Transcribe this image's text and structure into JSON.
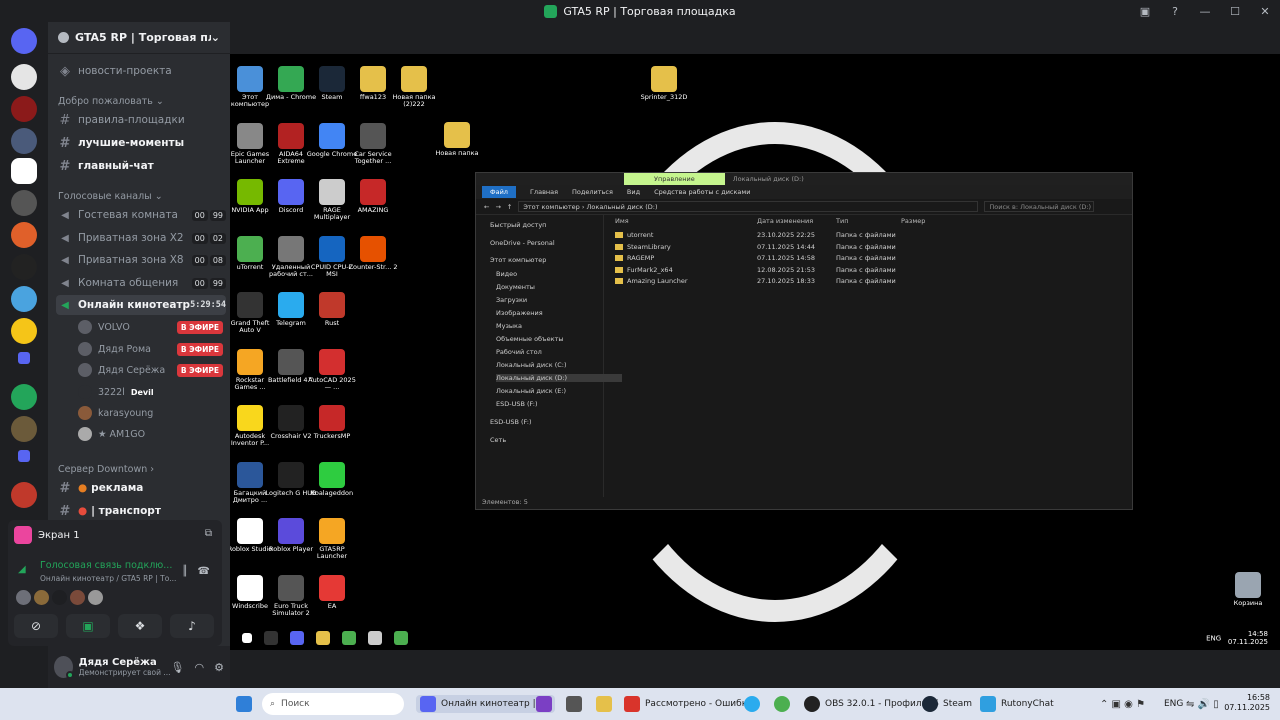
{
  "window": {
    "title": "GTA5 RP | Торговая площадка"
  },
  "server": {
    "name": "GTA5 RP | Торговая пло..."
  },
  "channels": {
    "news": "новости-проекта",
    "welcome_category": "Добро пожаловать",
    "rules": "правила-площадки",
    "best_moments": "лучшие-моменты",
    "main_chat": "главный-чат",
    "voice_category": "Голосовые каналы",
    "voice": [
      {
        "name": "Гостевая комната",
        "a": "00",
        "b": "99"
      },
      {
        "name": "Приватная зона X2",
        "a": "00",
        "b": "02"
      },
      {
        "name": "Приватная зона X8",
        "a": "00",
        "b": "08"
      },
      {
        "name": "Комната общения",
        "a": "00",
        "b": "99"
      }
    ],
    "cinema": {
      "name": "Онлайн кинотеатр",
      "timer": "5:29:54"
    },
    "cinema_users": [
      {
        "name": "VOLVO",
        "live": "В ЭФИРЕ"
      },
      {
        "name": "Дядя Рома",
        "live": "В ЭФИРЕ"
      },
      {
        "name": "Дядя Серёжа",
        "live": "В ЭФИРЕ"
      },
      {
        "name": "3222l",
        "tag": "Devil"
      },
      {
        "name": "karasyoung"
      },
      {
        "name": "★ AM1GO"
      }
    ],
    "downtown_category": "Сервер Downtown",
    "ads": "реклама",
    "transport": "| транспорт"
  },
  "voice_panel": {
    "screen": "Экран 1",
    "status": "Голосовая связь подклю...",
    "sub": "Онлайн кинотеатр / GTA5 RP | То..."
  },
  "user": {
    "name": "Дядя Серёжа",
    "status": "Демонстрирует свой ..."
  },
  "desktop": {
    "icons": [
      [
        "Этот компьютер",
        "Дима - Chrome",
        "Steam",
        "ffwa123",
        "Новая папка (2)222"
      ],
      [
        "Epic Games Launcher",
        "AIDA64 Extreme",
        "Google Chrome",
        "Car Service Together ..."
      ],
      [
        "NVIDIA App",
        "Discord",
        "RAGE Multiplayer",
        "AMAZING"
      ],
      [
        "uTorrent",
        "Удаленный рабочий ст...",
        "CPUID CPU-Z MSI",
        "Counter-Str... 2"
      ],
      [
        "Grand Theft Auto V",
        "Telegram",
        "Rust"
      ],
      [
        "Rockstar Games ...",
        "Battlefield 4™",
        "AutoCAD 2025 — ..."
      ],
      [
        "Autodesk Inventor P...",
        "Crosshair V2",
        "TruckersMP"
      ],
      [
        "Багацкий Дмитро ...",
        "Logitech G HUB",
        "Koalageddon"
      ],
      [
        "Roblox Studio",
        "Roblox Player",
        "GTA5RP Launcher"
      ],
      [
        "Windscribe",
        "Euro Truck Simulator 2",
        "EA"
      ]
    ],
    "extra": {
      "sprinter": "Sprinter_312D",
      "new_folder": "Новая папка",
      "trash": "Корзина"
    }
  },
  "explorer": {
    "manage_tab": "Управление",
    "title": "Локальный диск (D:)",
    "ribbon": [
      "Файл",
      "Главная",
      "Поделиться",
      "Вид",
      "Средства работы с дисками"
    ],
    "address": [
      "Этот компьютер",
      "Локальный диск (D:)"
    ],
    "search_placeholder": "Поиск в: Локальный диск (D:)",
    "nav": [
      "Быстрый доступ",
      "OneDrive - Personal",
      "Этот компьютер",
      "Видео",
      "Документы",
      "Загрузки",
      "Изображения",
      "Музыка",
      "Объемные объекты",
      "Рабочий стол",
      "Локальный диск (C:)",
      "Локальный диск (D:)",
      "Локальный диск (E:)",
      "ESD-USB (F:)",
      "ESD-USB (F:)",
      "Сеть"
    ],
    "columns": [
      "Имя",
      "Дата изменения",
      "Тип",
      "Размер"
    ],
    "rows": [
      [
        "utorrent",
        "23.10.2025 22:25",
        "Папка с файлами"
      ],
      [
        "SteamLibrary",
        "07.11.2025 14:44",
        "Папка с файлами"
      ],
      [
        "RAGEMP",
        "07.11.2025 14:58",
        "Папка с файлами"
      ],
      [
        "FurMark2_x64",
        "12.08.2025 21:53",
        "Папка с файлами"
      ],
      [
        "Amazing Launcher",
        "27.10.2025 18:33",
        "Папка с файлами"
      ]
    ],
    "status": "Элементов: 5"
  },
  "inner_tray": {
    "lang": "ENG",
    "time": "14:58",
    "date": "07.11.2025"
  },
  "taskbar": {
    "search": "Поиск",
    "items": [
      "Онлайн кинотеатр | GT",
      "Рассмотрено - Ошибка",
      "OBS 32.0.1 - Профиль: Б",
      "Steam",
      "RutonyChat"
    ],
    "lang": "ENG",
    "time": "16:58",
    "date": "07.11.2025"
  }
}
